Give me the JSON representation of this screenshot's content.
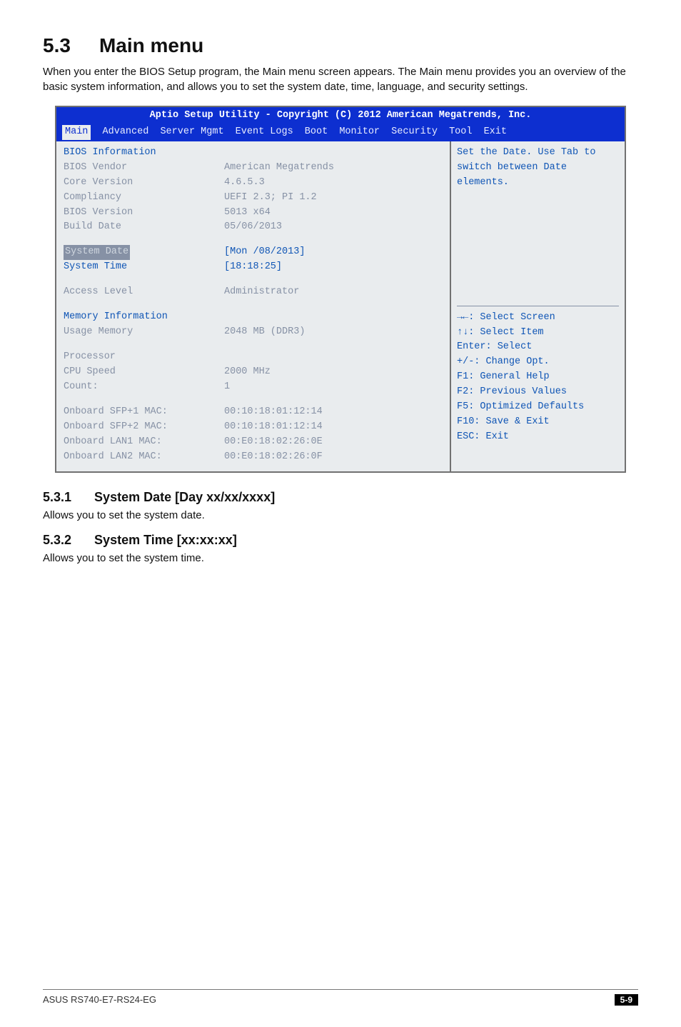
{
  "heading": {
    "num": "5.3",
    "title": "Main menu"
  },
  "intro": "When you enter the BIOS Setup program, the Main menu screen appears. The Main menu provides you an overview of the basic system information, and allows you to set the system date, time, language, and security settings.",
  "bios": {
    "title": "Aptio Setup Utility - Copyright (C) 2012 American Megatrends, Inc.",
    "menu": [
      "Main",
      "Advanced",
      "Server Mgmt",
      "Event Logs",
      "Boot",
      "Monitor",
      "Security",
      "Tool",
      "Exit"
    ],
    "left": {
      "bios_info_header": "BIOS Information",
      "vendor_label": "BIOS Vendor",
      "vendor_value": "American Megatrends",
      "corev_label": "Core Version",
      "corev_value": "4.6.5.3",
      "compl_label": "Compliancy",
      "compl_value": "UEFI 2.3; PI 1.2",
      "biosv_label": "BIOS Version",
      "biosv_value": "5013 x64",
      "buildd_label": "Build Date",
      "buildd_value": "05/06/2013",
      "sysdate_label": "System Date",
      "sysdate_value": "[Mon   /08/2013]",
      "systime_label": "System Time",
      "systime_value": "[18:18:25]",
      "access_label": "Access Level",
      "access_value": "Administrator",
      "meminfo_header": "Memory Information",
      "usage_label": "Usage Memory",
      "usage_value": "2048 MB (DDR3)",
      "proc_header": "Processor",
      "cpus_label": "CPU Speed",
      "cpus_value": "2000 MHz",
      "count_label": "Count:",
      "count_value": "1",
      "mac1_label": "Onboard SFP+1 MAC:",
      "mac1_value": "00:10:18:01:12:14",
      "mac2_label": "Onboard SFP+2 MAC:",
      "mac2_value": "00:10:18:01:12:14",
      "mac3_label": "Onboard LAN1 MAC:",
      "mac3_value": "00:E0:18:02:26:0E",
      "mac4_label": "Onboard LAN2 MAC:",
      "mac4_value": "00:E0:18:02:26:0F"
    },
    "right": {
      "help1": "Set the Date. Use Tab to",
      "help2": "switch between Date elements.",
      "nav": [
        "→←: Select Screen",
        "↑↓: Select Item",
        "Enter: Select",
        "+/-: Change Opt.",
        "F1: General Help",
        "F2: Previous Values",
        "F5: Optimized Defaults",
        "F10: Save & Exit",
        "ESC: Exit"
      ]
    }
  },
  "sec1": {
    "num": "5.3.1",
    "title": "System Date [Day xx/xx/xxxx]",
    "text": "Allows you to set the system date."
  },
  "sec2": {
    "num": "5.3.2",
    "title": "System Time [xx:xx:xx]",
    "text": "Allows you to set the system time."
  },
  "footer": {
    "left": "ASUS RS740-E7-RS24-EG",
    "page": "5-9"
  }
}
